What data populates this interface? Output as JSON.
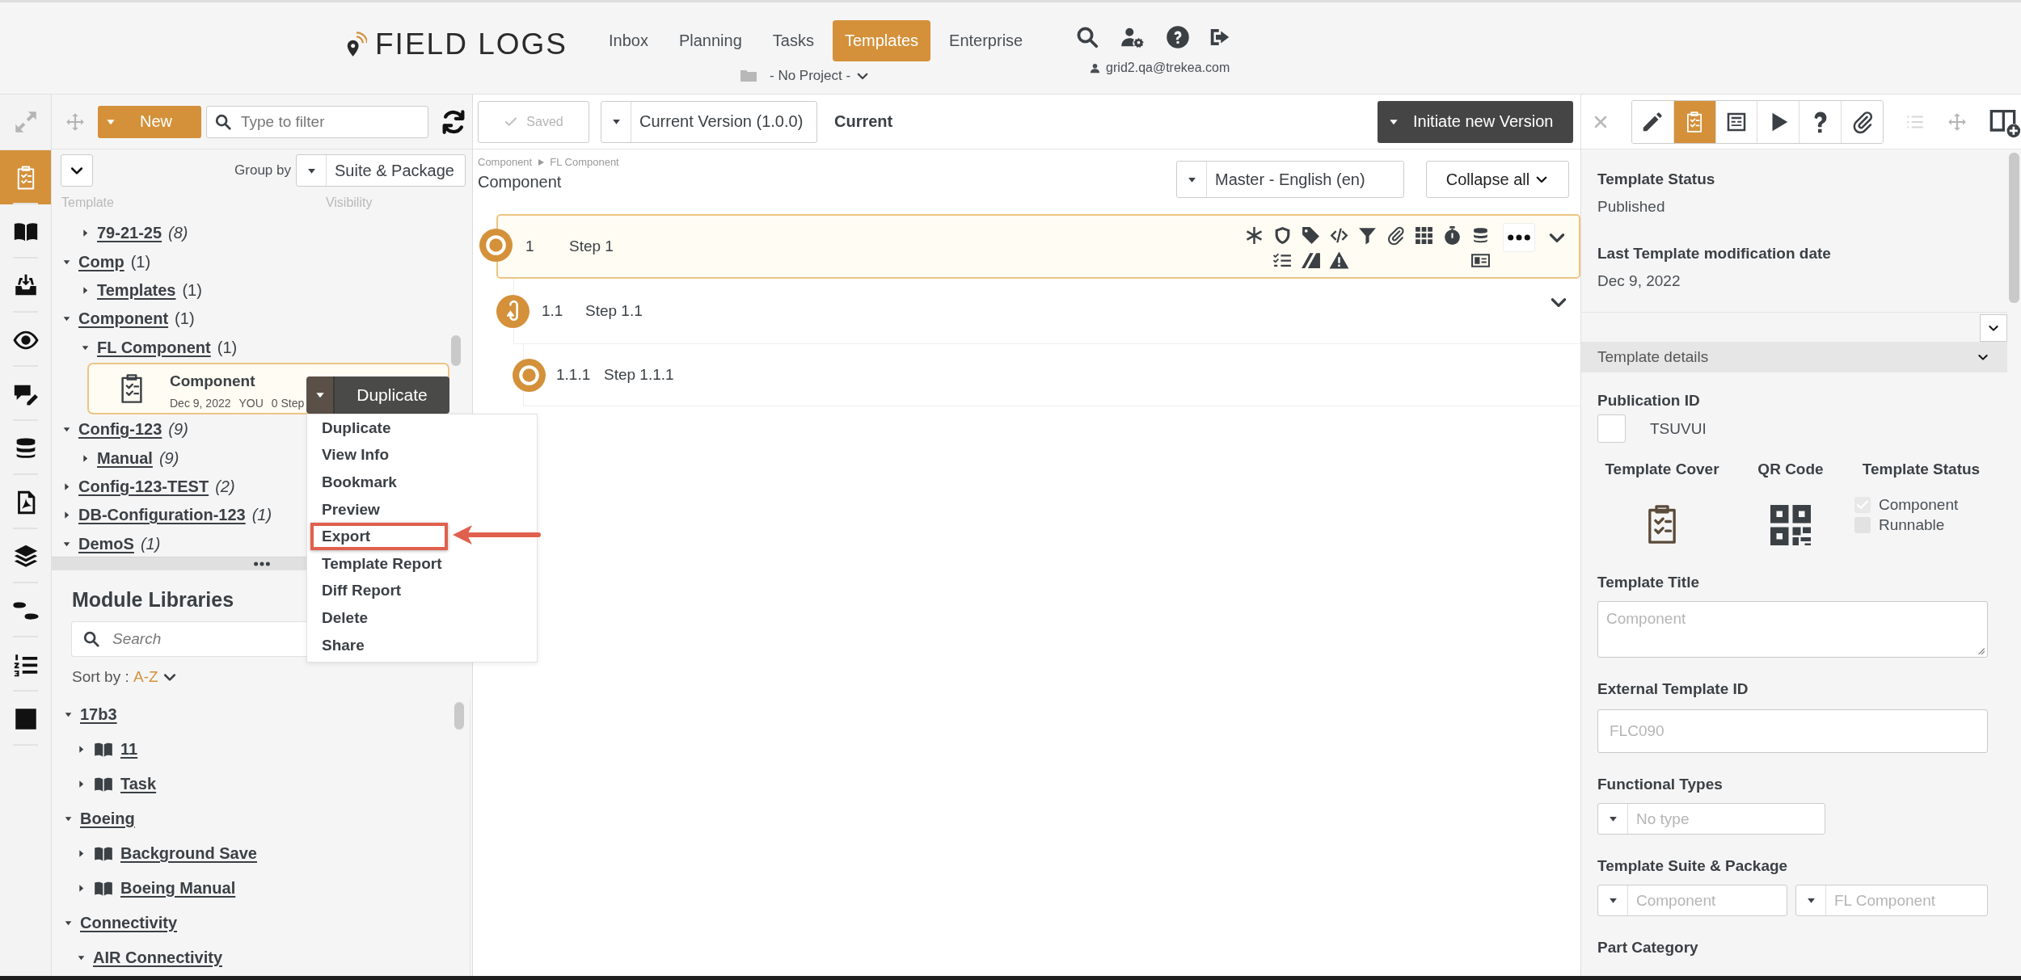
{
  "header": {
    "logo": "FIELD LOGS",
    "nav": [
      {
        "label": "Inbox",
        "selected": false
      },
      {
        "label": "Planning",
        "selected": false
      },
      {
        "label": "Tasks",
        "selected": false
      },
      {
        "label": "Templates",
        "selected": true
      },
      {
        "label": "Enterprise",
        "selected": false
      }
    ],
    "project": "- No Project -",
    "user": "grid2.qa@trekea.com"
  },
  "rail": [
    {
      "kind": "templates",
      "selected": true
    },
    {
      "kind": "library",
      "selected": false
    },
    {
      "kind": "inbox",
      "selected": false
    },
    {
      "kind": "preview",
      "selected": false
    },
    {
      "kind": "comments",
      "selected": false
    },
    {
      "kind": "database",
      "selected": false
    },
    {
      "kind": "pdf",
      "selected": false
    },
    {
      "kind": "layers",
      "selected": false
    },
    {
      "kind": "steps",
      "selected": false
    },
    {
      "kind": "list",
      "selected": false
    },
    {
      "kind": "stop",
      "selected": false
    }
  ],
  "templates_panel": {
    "new_button": "New",
    "filter_placeholder": "Type to filter",
    "group_by_label": "Group by",
    "group_by_value": "Suite & Package",
    "columns": [
      "Template",
      "Visibility"
    ],
    "tree": [
      {
        "children": [
          {
            "kind": "group",
            "label": "79-21-25",
            "count": "(8)",
            "italic": true,
            "expanded": false
          }
        ]
      },
      {
        "kind": "group",
        "label": "Comp",
        "count": "(1)",
        "italic": false,
        "expanded": true,
        "children": [
          {
            "kind": "group",
            "label": "Templates",
            "count": "(1)",
            "italic": false,
            "expanded": false
          }
        ]
      },
      {
        "kind": "group",
        "label": "Component",
        "count": "(1)",
        "italic": false,
        "expanded": true,
        "children": [
          {
            "kind": "group",
            "label": "FL Component",
            "count": "(1)",
            "italic": false,
            "expanded": true,
            "children": [
              {
                "kind": "template",
                "label": "Component",
                "date": "Dec 9, 2022",
                "author": "YOU",
                "steps": "0 Step",
                "selected": true
              }
            ]
          }
        ]
      },
      {
        "kind": "group",
        "label": "Config-123",
        "count": "(9)",
        "italic": true,
        "expanded": true,
        "children": [
          {
            "kind": "group",
            "label": "Manual",
            "count": "(9)",
            "italic": true,
            "expanded": false
          }
        ]
      },
      {
        "kind": "group",
        "label": "Config-123-TEST",
        "count": "(2)",
        "italic": true,
        "expanded": false
      },
      {
        "kind": "group",
        "label": "DB-Configuration-123",
        "count": "(1)",
        "italic": true,
        "expanded": false
      },
      {
        "kind": "group",
        "label": "DemoS",
        "count": "(1)",
        "italic": true,
        "expanded": true
      }
    ],
    "action_button": "Duplicate",
    "menu": [
      {
        "label": "Duplicate",
        "highlighted": false
      },
      {
        "label": "View Info",
        "highlighted": false
      },
      {
        "label": "Bookmark",
        "highlighted": false
      },
      {
        "label": "Preview",
        "highlighted": false
      },
      {
        "label": "Export",
        "highlighted": true
      },
      {
        "label": "Template Report",
        "highlighted": false
      },
      {
        "label": "Diff Report",
        "highlighted": false
      },
      {
        "label": "Delete",
        "highlighted": false
      },
      {
        "label": "Share",
        "highlighted": false
      }
    ]
  },
  "module_libraries": {
    "title": "Module Libraries",
    "search_placeholder": "Search",
    "sort_label": "Sort by :",
    "sort_value": "A-Z",
    "tree": [
      {
        "kind": "group",
        "label": "17b3",
        "expanded": true,
        "children": [
          {
            "kind": "book",
            "label": "11",
            "expanded": false
          },
          {
            "kind": "book",
            "label": "Task",
            "expanded": false
          }
        ]
      },
      {
        "kind": "group",
        "label": "Boeing",
        "expanded": true,
        "children": [
          {
            "kind": "book",
            "label": "Background Save",
            "expanded": false
          },
          {
            "kind": "book",
            "label": "Boeing Manual",
            "expanded": false
          }
        ]
      },
      {
        "kind": "group",
        "label": "Connectivity",
        "expanded": true,
        "children": [
          {
            "kind": "group",
            "label": "AIR Connectivity",
            "expanded": true
          }
        ]
      }
    ]
  },
  "editor": {
    "saved": "Saved",
    "version": "Current Version (1.0.0)",
    "version_state": "Current",
    "initiate": "Initiate new Version",
    "breadcrumb": [
      "Component",
      "FL Component"
    ],
    "title": "Component",
    "language": "Master - English (en)",
    "collapse": "Collapse all",
    "steps": [
      {
        "kind": "record",
        "number": "1",
        "title": "Step 1",
        "selected": true,
        "expanded": true,
        "children": [
          {
            "kind": "loop",
            "number": "1.1",
            "title": "Step 1.1",
            "selected": false,
            "expanded": true,
            "children": [
              {
                "kind": "record",
                "number": "1.1.1",
                "title": "Step 1.1.1",
                "selected": false
              }
            ]
          }
        ]
      }
    ]
  },
  "details": {
    "tabs": [
      {
        "kind": "edit",
        "selected": false
      },
      {
        "kind": "template",
        "selected": true
      },
      {
        "kind": "form",
        "selected": false
      },
      {
        "kind": "run",
        "selected": false
      },
      {
        "kind": "help",
        "selected": false
      },
      {
        "kind": "attachments",
        "selected": false
      }
    ],
    "status_label": "Template Status",
    "status": "Published",
    "modified_label": "Last Template modification date",
    "modified": "Dec 9, 2022",
    "section": "Template details",
    "publication_label": "Publication ID",
    "publication_checked": false,
    "publication_id": "TSUVUI",
    "cover_label": "Template Cover",
    "qr_label": "QR Code",
    "type_label": "Template Status",
    "type_options": [
      {
        "label": "Component",
        "checked": true
      },
      {
        "label": "Runnable",
        "checked": false
      }
    ],
    "title_label": "Template Title",
    "title_value": "Component",
    "external_label": "External Template ID",
    "external_value": "FLC090",
    "types_label": "Functional Types",
    "types_value": "No type",
    "suite_label": "Template Suite & Package",
    "suite_value": "Component",
    "package_value": "FL Component",
    "part_label": "Part Category"
  }
}
